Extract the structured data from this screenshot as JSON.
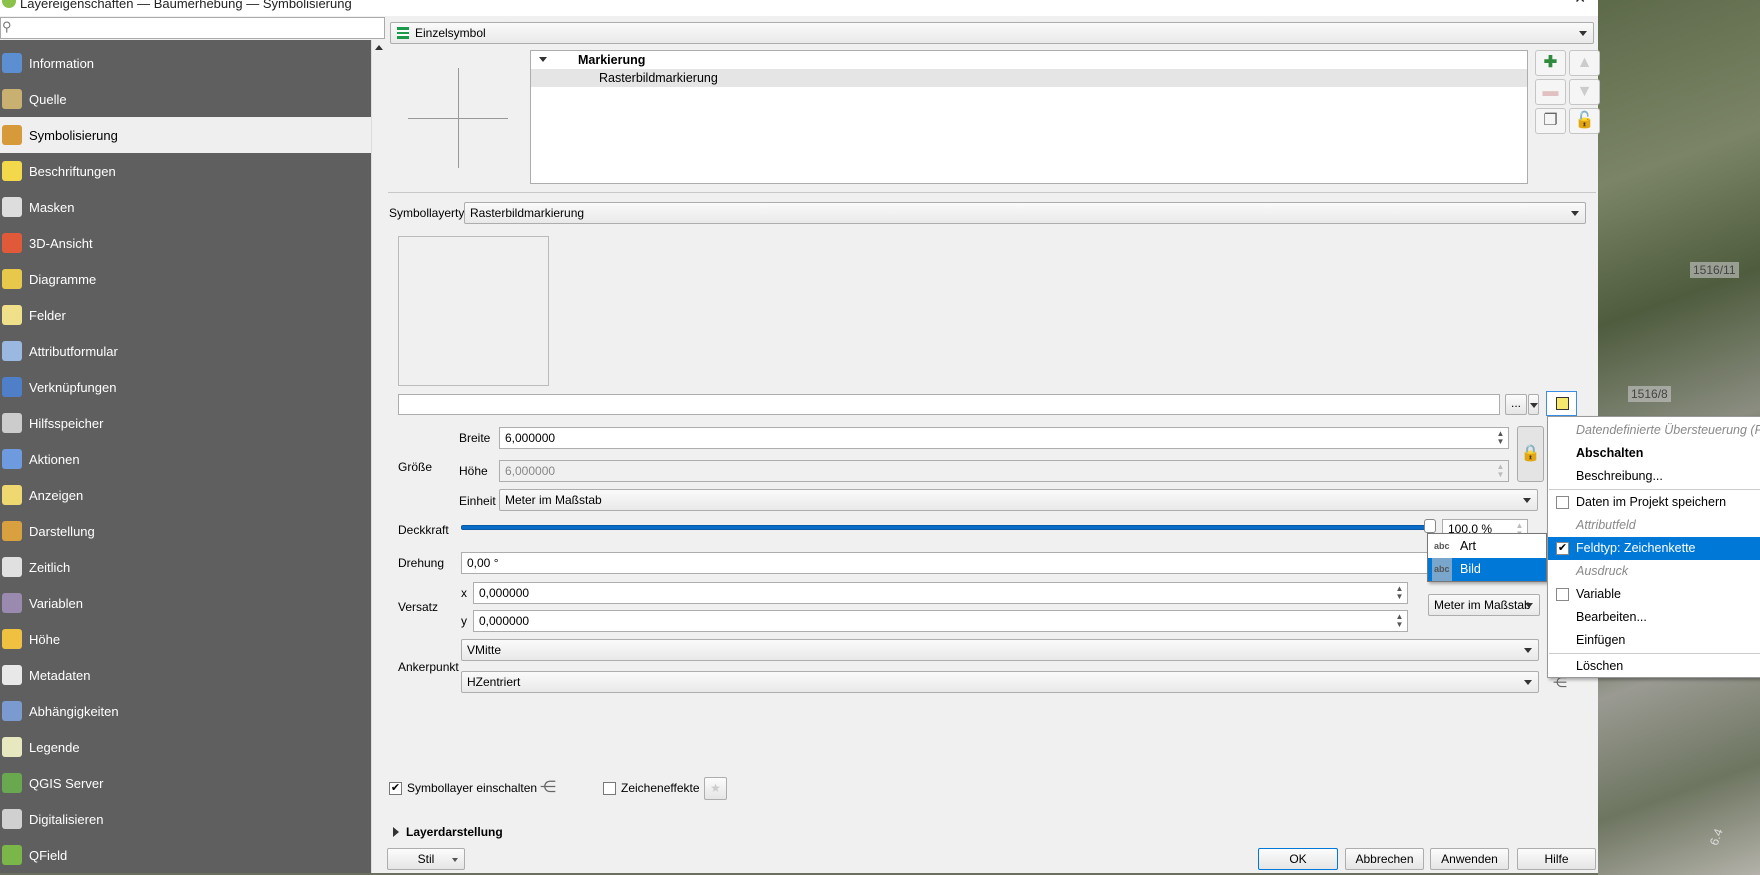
{
  "window": {
    "title": "Layereigenschaften — Baumerhebung — Symbolisierung"
  },
  "search": {
    "placeholder": ""
  },
  "sidebar": {
    "items": [
      {
        "label": "Information",
        "color": "#5b8fd1"
      },
      {
        "label": "Quelle",
        "color": "#c8b070"
      },
      {
        "label": "Symbolisierung",
        "color": "#d79a3a"
      },
      {
        "label": "Beschriftungen",
        "color": "#f2d84a"
      },
      {
        "label": "Masken",
        "color": "#dddddd"
      },
      {
        "label": "3D-Ansicht",
        "color": "#e05a3a"
      },
      {
        "label": "Diagramme",
        "color": "#e8c84a"
      },
      {
        "label": "Felder",
        "color": "#f0e08a"
      },
      {
        "label": "Attributformular",
        "color": "#9ab8e0"
      },
      {
        "label": "Verknüpfungen",
        "color": "#4f7fc8"
      },
      {
        "label": "Hilfsspeicher",
        "color": "#cccccc"
      },
      {
        "label": "Aktionen",
        "color": "#6e9be0"
      },
      {
        "label": "Anzeigen",
        "color": "#f0d870"
      },
      {
        "label": "Darstellung",
        "color": "#d9a040"
      },
      {
        "label": "Zeitlich",
        "color": "#e0e0e0"
      },
      {
        "label": "Variablen",
        "color": "#9a8ab0"
      },
      {
        "label": "Höhe",
        "color": "#f0c040"
      },
      {
        "label": "Metadaten",
        "color": "#e8e8e8"
      },
      {
        "label": "Abhängigkeiten",
        "color": "#7a9ad0"
      },
      {
        "label": "Legende",
        "color": "#e8e8c0"
      },
      {
        "label": "QGIS Server",
        "color": "#6aa84f"
      },
      {
        "label": "Digitalisieren",
        "color": "#d0d0d0"
      },
      {
        "label": "QField",
        "color": "#7ab648"
      }
    ],
    "selected": "Symbolisierung"
  },
  "renderer": {
    "value": "Einzelsymbol"
  },
  "tree": {
    "root": "Markierung",
    "child": "Rasterbildmarkierung"
  },
  "symbol_layer_type": {
    "label": "Symbollayertyp",
    "value": "Rasterbildmarkierung"
  },
  "path": {
    "value": "",
    "browse": "..."
  },
  "size": {
    "group": "Größe",
    "width_label": "Breite",
    "width": "6,000000",
    "height_label": "Höhe",
    "height": "6,000000",
    "unit_label": "Einheit",
    "unit": "Meter im Maßstab"
  },
  "opacity": {
    "label": "Deckkraft",
    "value": "100,0 %",
    "fraction": 1.0
  },
  "rotation": {
    "label": "Drehung",
    "value": "0,00 °"
  },
  "offset": {
    "label": "Versatz",
    "x_label": "x",
    "x": "0,000000",
    "y_label": "y",
    "y": "0,000000",
    "unit": "Meter im Maßstab"
  },
  "anchor": {
    "label": "Ankerpunkt",
    "v": "VMitte",
    "h": "HZentriert"
  },
  "field_popup": {
    "items": [
      {
        "type": "abc",
        "label": "Art"
      },
      {
        "type": "abc",
        "label": "Bild"
      }
    ],
    "selected": "Bild"
  },
  "context_menu": {
    "header": "Datendefinierte Übersteuerung (Feld)",
    "off": "Abschalten",
    "describe": "Beschreibung...",
    "store": "Daten im Projekt speichern",
    "attr_header": "Attributfeld",
    "field": "Feldtyp: Zeichenkette",
    "expr_header": "Ausdruck",
    "variable": "Variable",
    "edit": "Bearbeiten...",
    "paste": "Einfügen",
    "clear": "Löschen"
  },
  "bottom": {
    "enable_layer": "Symbollayer einschalten",
    "enable_checked": true,
    "effects": "Zeicheneffekte",
    "effects_checked": false,
    "layer_rendering": "Layerdarstellung",
    "style": "Stil",
    "ok": "OK",
    "cancel": "Abbrechen",
    "apply": "Anwenden",
    "help": "Hilfe"
  },
  "map": {
    "labels": [
      "1516/11",
      "1516/8",
      "6.4"
    ]
  }
}
